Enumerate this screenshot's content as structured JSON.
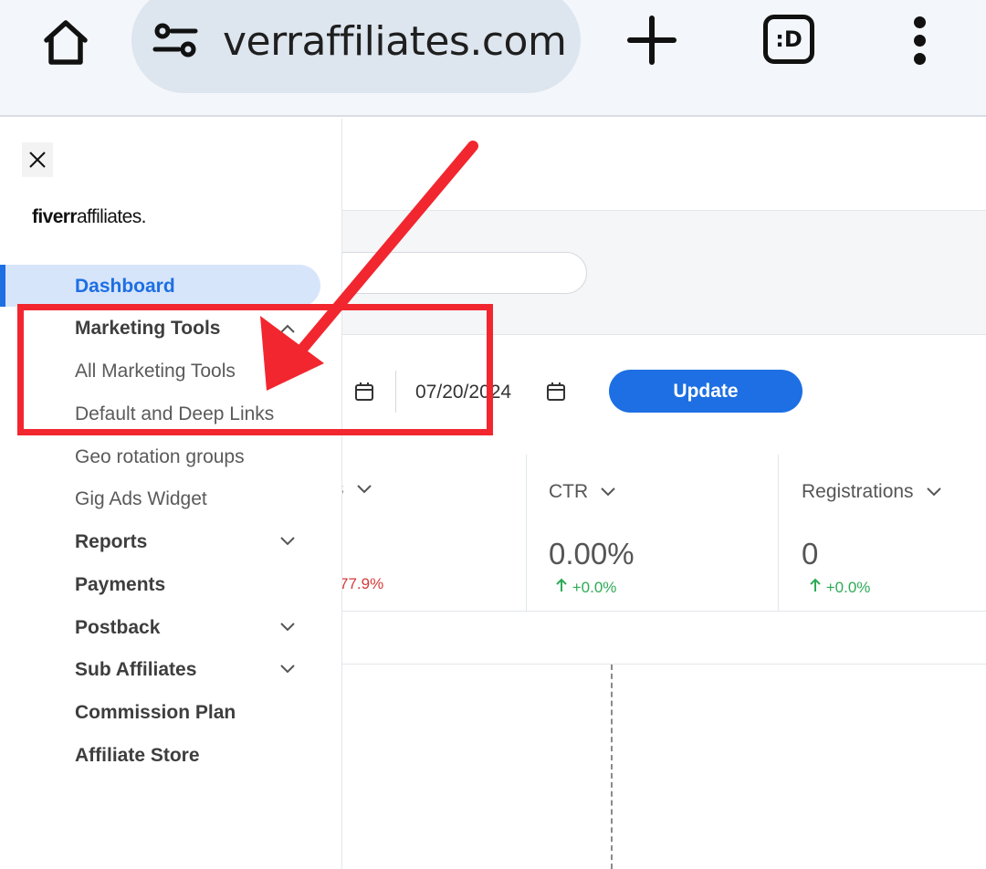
{
  "browser": {
    "url": "verraffiliates.com",
    "tab_count_label": ":D",
    "icons": [
      "home-icon",
      "site-settings-icon",
      "plus-icon",
      "tab-switcher-icon",
      "more-vert-icon"
    ]
  },
  "sidebar": {
    "logo_bold": "fiverr",
    "logo_light": "affiliates.",
    "items": [
      {
        "label": "Dashboard",
        "active": true
      },
      {
        "label": "Marketing Tools",
        "expanded": true
      },
      {
        "label": "All Marketing Tools"
      },
      {
        "label": "Default and Deep Links"
      },
      {
        "label": "Geo rotation groups"
      },
      {
        "label": "Gig Ads Widget"
      },
      {
        "label": "Reports"
      },
      {
        "label": "Payments"
      },
      {
        "label": "Postback"
      },
      {
        "label": "Sub Affiliates"
      },
      {
        "label": "Commission Plan"
      },
      {
        "label": "Affiliate Store"
      }
    ]
  },
  "filters": {
    "end_date": "07/20/2024",
    "update_label": "Update"
  },
  "stats": [
    {
      "label_fragment": "s",
      "change": "77.9%"
    },
    {
      "label": "CTR",
      "value": "0.00%",
      "change": "+0.0%"
    },
    {
      "label": "Registrations",
      "value": "0",
      "change": "+0.0%"
    }
  ],
  "colors": {
    "accent": "#1d6fe3",
    "active_bg": "#d7e5fb",
    "annotation": "#f2262f",
    "positive": "#2eaa57",
    "negative": "#d63a3a"
  }
}
